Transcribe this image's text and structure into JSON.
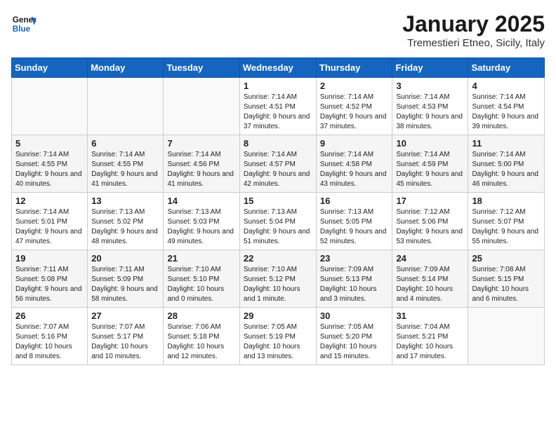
{
  "header": {
    "logo_general": "General",
    "logo_blue": "Blue",
    "month": "January 2025",
    "location": "Tremestieri Etneo, Sicily, Italy"
  },
  "weekdays": [
    "Sunday",
    "Monday",
    "Tuesday",
    "Wednesday",
    "Thursday",
    "Friday",
    "Saturday"
  ],
  "weeks": [
    [
      {
        "day": "",
        "info": ""
      },
      {
        "day": "",
        "info": ""
      },
      {
        "day": "",
        "info": ""
      },
      {
        "day": "1",
        "info": "Sunrise: 7:14 AM\nSunset: 4:51 PM\nDaylight: 9 hours and 37 minutes."
      },
      {
        "day": "2",
        "info": "Sunrise: 7:14 AM\nSunset: 4:52 PM\nDaylight: 9 hours and 37 minutes."
      },
      {
        "day": "3",
        "info": "Sunrise: 7:14 AM\nSunset: 4:53 PM\nDaylight: 9 hours and 38 minutes."
      },
      {
        "day": "4",
        "info": "Sunrise: 7:14 AM\nSunset: 4:54 PM\nDaylight: 9 hours and 39 minutes."
      }
    ],
    [
      {
        "day": "5",
        "info": "Sunrise: 7:14 AM\nSunset: 4:55 PM\nDaylight: 9 hours and 40 minutes."
      },
      {
        "day": "6",
        "info": "Sunrise: 7:14 AM\nSunset: 4:55 PM\nDaylight: 9 hours and 41 minutes."
      },
      {
        "day": "7",
        "info": "Sunrise: 7:14 AM\nSunset: 4:56 PM\nDaylight: 9 hours and 41 minutes."
      },
      {
        "day": "8",
        "info": "Sunrise: 7:14 AM\nSunset: 4:57 PM\nDaylight: 9 hours and 42 minutes."
      },
      {
        "day": "9",
        "info": "Sunrise: 7:14 AM\nSunset: 4:58 PM\nDaylight: 9 hours and 43 minutes."
      },
      {
        "day": "10",
        "info": "Sunrise: 7:14 AM\nSunset: 4:59 PM\nDaylight: 9 hours and 45 minutes."
      },
      {
        "day": "11",
        "info": "Sunrise: 7:14 AM\nSunset: 5:00 PM\nDaylight: 9 hours and 46 minutes."
      }
    ],
    [
      {
        "day": "12",
        "info": "Sunrise: 7:14 AM\nSunset: 5:01 PM\nDaylight: 9 hours and 47 minutes."
      },
      {
        "day": "13",
        "info": "Sunrise: 7:13 AM\nSunset: 5:02 PM\nDaylight: 9 hours and 48 minutes."
      },
      {
        "day": "14",
        "info": "Sunrise: 7:13 AM\nSunset: 5:03 PM\nDaylight: 9 hours and 49 minutes."
      },
      {
        "day": "15",
        "info": "Sunrise: 7:13 AM\nSunset: 5:04 PM\nDaylight: 9 hours and 51 minutes."
      },
      {
        "day": "16",
        "info": "Sunrise: 7:13 AM\nSunset: 5:05 PM\nDaylight: 9 hours and 52 minutes."
      },
      {
        "day": "17",
        "info": "Sunrise: 7:12 AM\nSunset: 5:06 PM\nDaylight: 9 hours and 53 minutes."
      },
      {
        "day": "18",
        "info": "Sunrise: 7:12 AM\nSunset: 5:07 PM\nDaylight: 9 hours and 55 minutes."
      }
    ],
    [
      {
        "day": "19",
        "info": "Sunrise: 7:11 AM\nSunset: 5:08 PM\nDaylight: 9 hours and 56 minutes."
      },
      {
        "day": "20",
        "info": "Sunrise: 7:11 AM\nSunset: 5:09 PM\nDaylight: 9 hours and 58 minutes."
      },
      {
        "day": "21",
        "info": "Sunrise: 7:10 AM\nSunset: 5:10 PM\nDaylight: 10 hours and 0 minutes."
      },
      {
        "day": "22",
        "info": "Sunrise: 7:10 AM\nSunset: 5:12 PM\nDaylight: 10 hours and 1 minute."
      },
      {
        "day": "23",
        "info": "Sunrise: 7:09 AM\nSunset: 5:13 PM\nDaylight: 10 hours and 3 minutes."
      },
      {
        "day": "24",
        "info": "Sunrise: 7:09 AM\nSunset: 5:14 PM\nDaylight: 10 hours and 4 minutes."
      },
      {
        "day": "25",
        "info": "Sunrise: 7:08 AM\nSunset: 5:15 PM\nDaylight: 10 hours and 6 minutes."
      }
    ],
    [
      {
        "day": "26",
        "info": "Sunrise: 7:07 AM\nSunset: 5:16 PM\nDaylight: 10 hours and 8 minutes."
      },
      {
        "day": "27",
        "info": "Sunrise: 7:07 AM\nSunset: 5:17 PM\nDaylight: 10 hours and 10 minutes."
      },
      {
        "day": "28",
        "info": "Sunrise: 7:06 AM\nSunset: 5:18 PM\nDaylight: 10 hours and 12 minutes."
      },
      {
        "day": "29",
        "info": "Sunrise: 7:05 AM\nSunset: 5:19 PM\nDaylight: 10 hours and 13 minutes."
      },
      {
        "day": "30",
        "info": "Sunrise: 7:05 AM\nSunset: 5:20 PM\nDaylight: 10 hours and 15 minutes."
      },
      {
        "day": "31",
        "info": "Sunrise: 7:04 AM\nSunset: 5:21 PM\nDaylight: 10 hours and 17 minutes."
      },
      {
        "day": "",
        "info": ""
      }
    ]
  ]
}
